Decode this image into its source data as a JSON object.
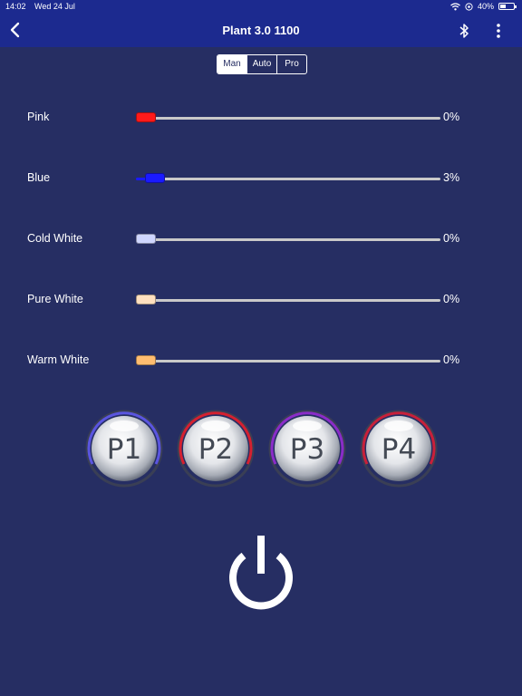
{
  "status": {
    "time": "14:02",
    "date": "Wed 24 Jul",
    "battery": "40%",
    "battery_level": 0.4
  },
  "nav": {
    "title": "Plant 3.0 1100",
    "back_icon": "chevron-left-icon",
    "bt_icon": "bluetooth-icon",
    "more_icon": "more-vertical-icon"
  },
  "modes": {
    "items": [
      "Man",
      "Auto",
      "Pro"
    ],
    "selected": "Man"
  },
  "channels": [
    {
      "label": "Pink",
      "value": "0%",
      "percent": 0,
      "color": "#ff1a1a"
    },
    {
      "label": "Blue",
      "value": "3%",
      "percent": 3,
      "color": "#1a1aff"
    },
    {
      "label": "Cold White",
      "value": "0%",
      "percent": 0,
      "color": "#cfd6ff"
    },
    {
      "label": "Pure White",
      "value": "0%",
      "percent": 0,
      "color": "#ffe0bf"
    },
    {
      "label": "Warm White",
      "value": "0%",
      "percent": 0,
      "color": "#ffbd70"
    }
  ],
  "presets": [
    {
      "label": "P1",
      "ring": "#5a55e0"
    },
    {
      "label": "P2",
      "ring": "#d42030"
    },
    {
      "label": "P3",
      "ring": "#8a2cc8"
    },
    {
      "label": "P4",
      "ring": "#c8203a"
    }
  ],
  "power_icon": "power-icon"
}
